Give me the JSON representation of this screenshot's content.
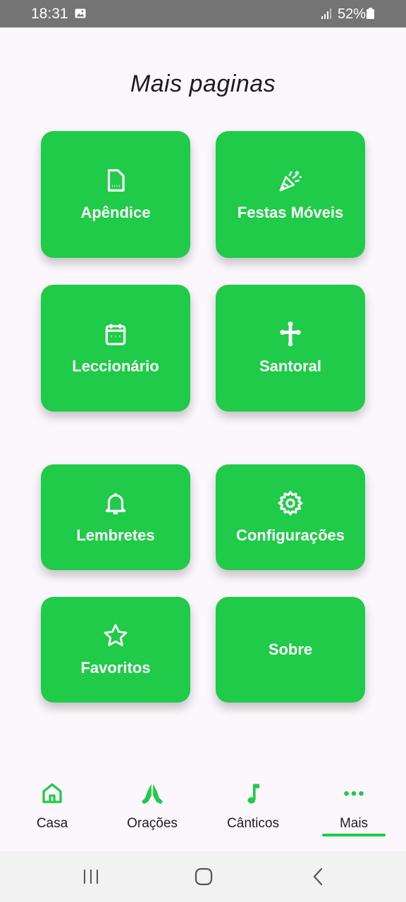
{
  "status_bar": {
    "time": "18:31",
    "battery": "52%"
  },
  "page": {
    "title": "Mais paginas"
  },
  "tiles": [
    {
      "label": "Apêndice",
      "icon": "document-icon"
    },
    {
      "label": "Festas Móveis",
      "icon": "party-popper-icon"
    },
    {
      "label": "Leccionário",
      "icon": "calendar-icon"
    },
    {
      "label": "Santoral",
      "icon": "cross-icon"
    },
    {
      "label": "Lembretes",
      "icon": "bell-icon"
    },
    {
      "label": "Configurações",
      "icon": "gear-icon"
    },
    {
      "label": "Favoritos",
      "icon": "star-icon"
    },
    {
      "label": "Sobre",
      "icon": ""
    }
  ],
  "nav": {
    "items": [
      {
        "label": "Casa",
        "icon": "home-icon"
      },
      {
        "label": "Orações",
        "icon": "praying-hands-icon"
      },
      {
        "label": "Cânticos",
        "icon": "music-note-icon"
      },
      {
        "label": "Mais",
        "icon": "more-dots-icon"
      }
    ],
    "active": "Mais"
  },
  "colors": {
    "accent": "#1fcb48",
    "background": "#fcf7fc",
    "status_bar": "#747474"
  }
}
